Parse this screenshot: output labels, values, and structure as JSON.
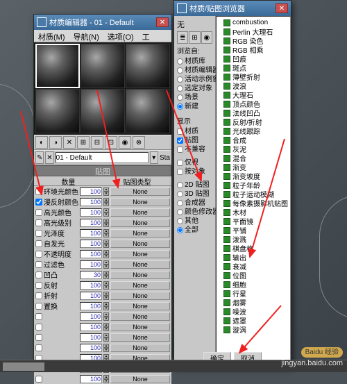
{
  "mat_editor": {
    "title": "材质编辑器 - 01 - Default",
    "menus": [
      "材质(M)",
      "导航(N)",
      "选项(O)",
      "工"
    ],
    "selected_material": "01 - Default",
    "sta_label": "Sta",
    "panel_title": "贴图",
    "columns": {
      "amount": "数量",
      "type": "贴图类型"
    },
    "default_value": "100",
    "none_label": "None",
    "rows": [
      {
        "label": "环境光颜色",
        "value": "100"
      },
      {
        "label": "漫反射颜色",
        "value": "100",
        "checked": true
      },
      {
        "label": "高光颜色",
        "value": "100"
      },
      {
        "label": "高光级别",
        "value": "100"
      },
      {
        "label": "光泽度",
        "value": "100"
      },
      {
        "label": "自发光",
        "value": "100"
      },
      {
        "label": "不透明度",
        "value": "100"
      },
      {
        "label": "过滤色",
        "value": "100"
      },
      {
        "label": "凹凸",
        "value": "30"
      },
      {
        "label": "反射",
        "value": "100"
      },
      {
        "label": "折射",
        "value": "100"
      },
      {
        "label": "置换",
        "value": "100"
      },
      {
        "label": " ",
        "value": "100"
      },
      {
        "label": " ",
        "value": "100"
      },
      {
        "label": " ",
        "value": "100"
      },
      {
        "label": " ",
        "value": "100"
      },
      {
        "label": " ",
        "value": "100"
      },
      {
        "label": " ",
        "value": "100"
      },
      {
        "label": " ",
        "value": "100"
      }
    ]
  },
  "browser": {
    "title": "材质/贴图浏览器",
    "search_label": "无",
    "groups": {
      "browse_from": {
        "title": "浏览自:",
        "items": [
          "材质库",
          "材质编辑器",
          "活动示例窗",
          "选定对象",
          "场景",
          "新建"
        ],
        "selected": 5
      },
      "show": {
        "title": "显示",
        "items": [
          "材质",
          "贴图",
          "不兼容"
        ],
        "checked": [
          false,
          true,
          false
        ]
      },
      "root": {
        "title": "",
        "items": [
          "仅根",
          "按对象"
        ],
        "checked": [
          false,
          false
        ]
      },
      "views": {
        "title": "",
        "items": [
          "2D 贴图",
          "3D 贴图",
          "合成器",
          "颜色修改器",
          "其他",
          "全部"
        ],
        "selected": 5
      }
    },
    "tree": [
      "combustion",
      "Perlin 大理石",
      "RGB 染色",
      "RGB 相乘",
      "凹痕",
      "斑点",
      "薄壁折射",
      "波浪",
      "大理石",
      "顶点颜色",
      "法线凹凸",
      "反射/折射",
      "光线跟踪",
      "合成",
      "灰泥",
      "混合",
      "渐变",
      "渐变坡度",
      "粒子年龄",
      "粒子运动模糊",
      "每像素摄影机贴图",
      "木材",
      "平面镜",
      "平铺",
      "泼溅",
      "棋盘格",
      "输出",
      "衰减",
      "位图",
      "细胞",
      "行星",
      "烟雾",
      "噪波",
      "遮罩",
      "漩涡"
    ],
    "ok": "确定",
    "cancel": "取消"
  },
  "watermark": {
    "badge": "Baidu 经验",
    "url": "jingyan.baidu.com"
  }
}
